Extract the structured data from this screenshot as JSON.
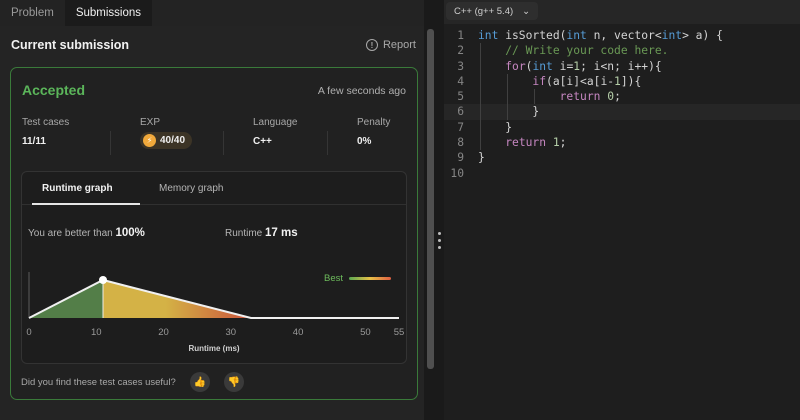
{
  "tabs": [
    {
      "label": "Problem"
    },
    {
      "label": "Submissions"
    }
  ],
  "panel": {
    "title": "Current submission",
    "report_label": "Report"
  },
  "result": {
    "status": "Accepted",
    "time": "A few seconds ago"
  },
  "stats": {
    "test_cases": {
      "label": "Test cases",
      "value": "11/11"
    },
    "exp": {
      "label": "EXP",
      "value": "40/40"
    },
    "language": {
      "label": "Language",
      "value": "C++"
    },
    "penalty": {
      "label": "Penalty",
      "value": "0%"
    }
  },
  "graph_tabs": {
    "runtime": "Runtime graph",
    "memory": "Memory graph"
  },
  "graph_summary": {
    "better_label": "You are better than",
    "better_value": "100%",
    "runtime_label": "Runtime",
    "runtime_value": "17 ms",
    "best_label": "Best"
  },
  "feedback": {
    "question": "Did you find these test cases useful?"
  },
  "editor": {
    "language_label": "C++ (g++ 5.4)"
  },
  "chart_data": {
    "type": "area",
    "xlabel": "Runtime (ms)",
    "ylabel": "",
    "xlim": [
      0,
      55
    ],
    "x_ticks": [
      0,
      10,
      20,
      30,
      40,
      50,
      55
    ],
    "points": [
      {
        "x": 0,
        "y": 0.0
      },
      {
        "x": 11,
        "y": 1.0
      },
      {
        "x": 33,
        "y": 0.0
      },
      {
        "x": 55,
        "y": 0.0
      }
    ],
    "marker": {
      "x": 11
    },
    "colors": {
      "left": "#5a8a4e",
      "mid": "#e8c34a",
      "right": "#de5a3f",
      "line": "#f0f0f0"
    }
  },
  "code": [
    [
      {
        "c": "kw",
        "t": "int"
      },
      {
        "c": "",
        "t": " isSorted("
      },
      {
        "c": "kw",
        "t": "int"
      },
      {
        "c": "",
        "t": " n, vector<"
      },
      {
        "c": "kw",
        "t": "int"
      },
      {
        "c": "",
        "t": "> a) {"
      }
    ],
    [
      {
        "c": "",
        "t": "    "
      },
      {
        "c": "cm",
        "t": "// Write your code here."
      }
    ],
    [
      {
        "c": "",
        "t": "    "
      },
      {
        "c": "ctl",
        "t": "for"
      },
      {
        "c": "",
        "t": "("
      },
      {
        "c": "kw",
        "t": "int"
      },
      {
        "c": "",
        "t": " i="
      },
      {
        "c": "num",
        "t": "1"
      },
      {
        "c": "",
        "t": "; i<n; i++){"
      }
    ],
    [
      {
        "c": "",
        "t": "        "
      },
      {
        "c": "ctl",
        "t": "if"
      },
      {
        "c": "",
        "t": "(a[i]<a[i-"
      },
      {
        "c": "num",
        "t": "1"
      },
      {
        "c": "",
        "t": "]){"
      }
    ],
    [
      {
        "c": "",
        "t": "            "
      },
      {
        "c": "ctl",
        "t": "return"
      },
      {
        "c": "",
        "t": " "
      },
      {
        "c": "num",
        "t": "0"
      },
      {
        "c": "",
        "t": ";"
      }
    ],
    [
      {
        "c": "",
        "t": "        }"
      }
    ],
    [
      {
        "c": "",
        "t": "    }"
      }
    ],
    [
      {
        "c": "",
        "t": "    "
      },
      {
        "c": "ctl",
        "t": "return"
      },
      {
        "c": "",
        "t": " "
      },
      {
        "c": "num",
        "t": "1"
      },
      {
        "c": "",
        "t": ";"
      }
    ],
    [
      {
        "c": "",
        "t": "}"
      }
    ],
    [
      {
        "c": "",
        "t": ""
      }
    ]
  ]
}
